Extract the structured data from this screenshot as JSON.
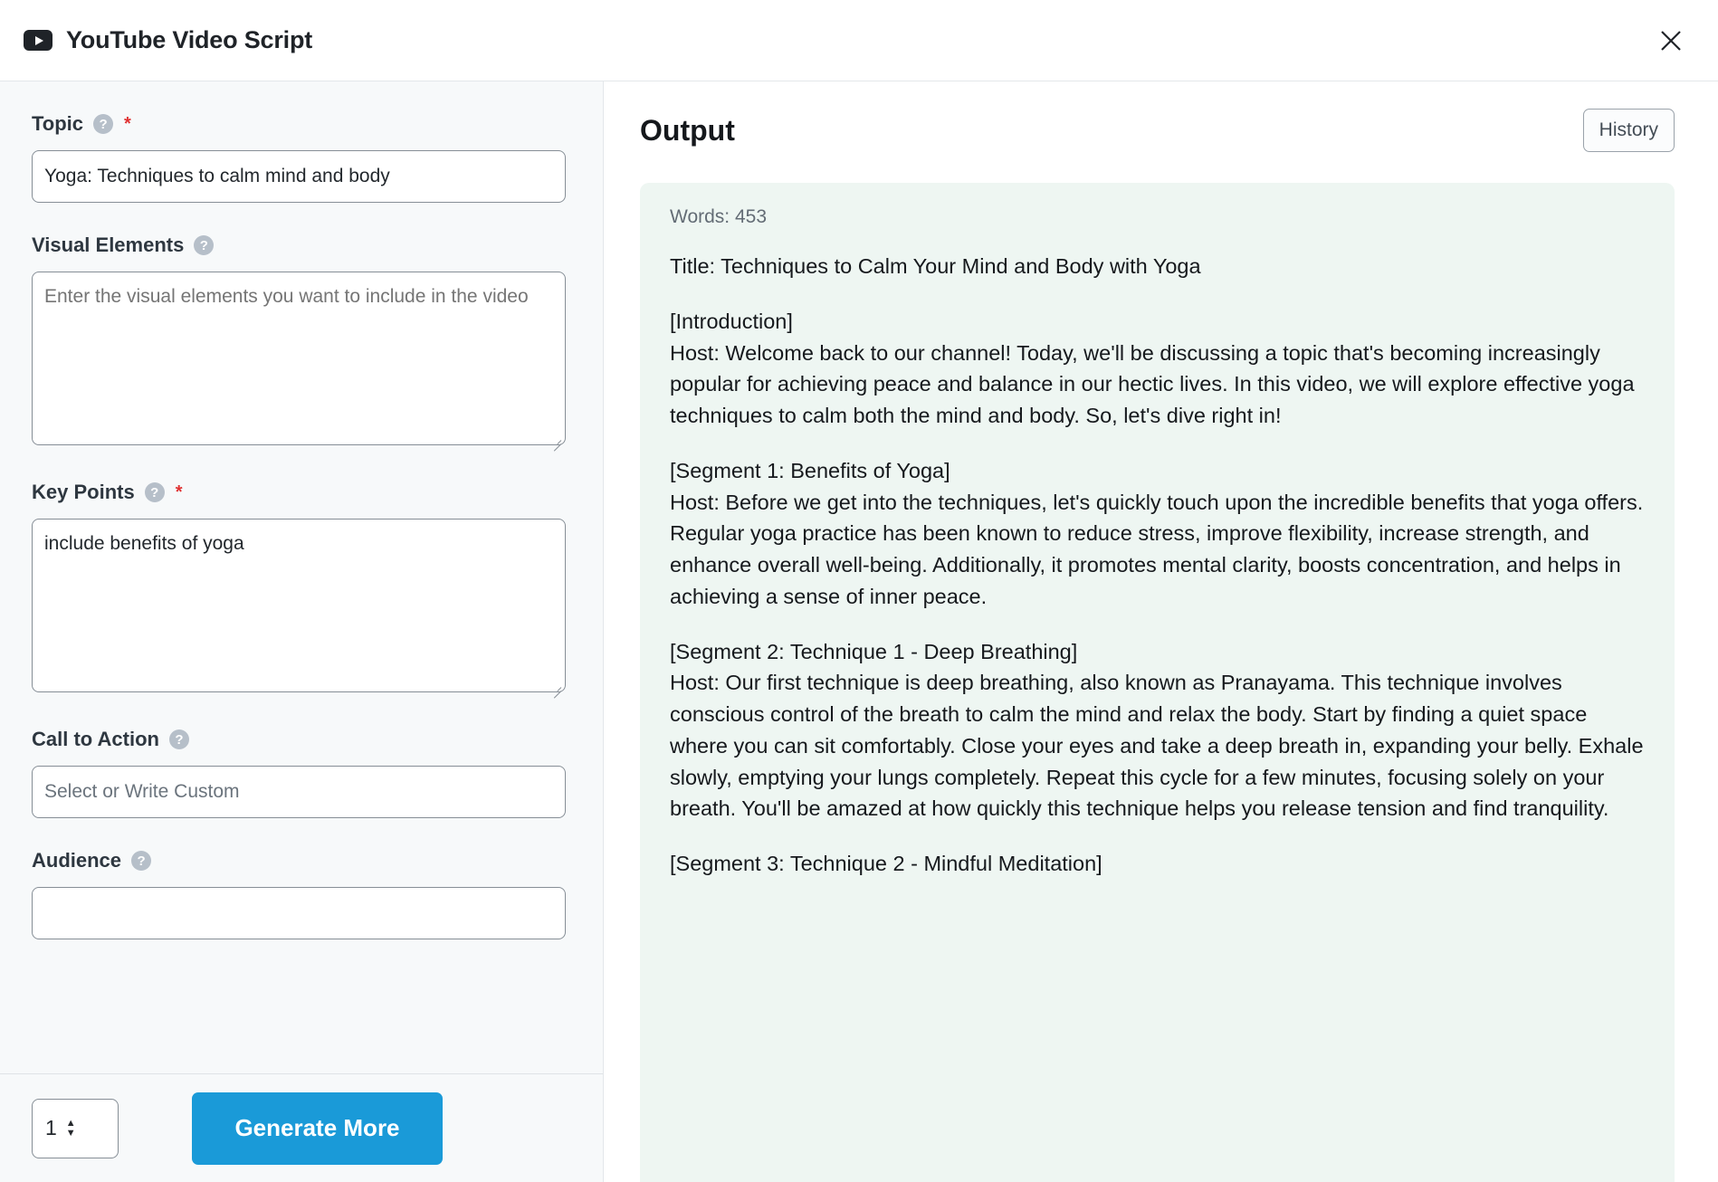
{
  "header": {
    "title": "YouTube Video Script",
    "logo_icon": "youtube-play-icon",
    "close_icon": "close-icon"
  },
  "form": {
    "fields": [
      {
        "label": "Topic",
        "help_icon": "help-circle-icon",
        "required_marker": "*",
        "type": "text",
        "value": "Yoga: Techniques to calm mind and body",
        "placeholder": ""
      },
      {
        "label": "Visual Elements",
        "help_icon": "help-circle-icon",
        "required_marker": "",
        "type": "textarea",
        "value": "",
        "placeholder": "Enter the visual elements you want to include in the video"
      },
      {
        "label": "Key Points",
        "help_icon": "help-circle-icon",
        "required_marker": "*",
        "type": "textarea",
        "value": "include benefits of yoga",
        "placeholder": ""
      },
      {
        "label": "Call to Action",
        "help_icon": "help-circle-icon",
        "required_marker": "",
        "type": "text",
        "value": "",
        "placeholder": "Select or Write Custom"
      },
      {
        "label": "Audience",
        "help_icon": "help-circle-icon",
        "required_marker": "",
        "type": "text",
        "value": "",
        "placeholder": ""
      }
    ]
  },
  "footer": {
    "count_value": "1",
    "stepper_up_icon": "chevron-up-icon",
    "stepper_down_icon": "chevron-down-icon",
    "generate_label": "Generate More"
  },
  "output": {
    "title": "Output",
    "history_label": "History",
    "words_label": "Words: 453",
    "paragraphs": [
      "Title: Techniques to Calm Your Mind and Body with Yoga",
      "[Introduction]\nHost: Welcome back to our channel! Today, we'll be discussing a topic that's becoming increasingly popular for achieving peace and balance in our hectic lives. In this video, we will explore effective yoga techniques to calm both the mind and body. So, let's dive right in!",
      "[Segment 1: Benefits of Yoga]\nHost: Before we get into the techniques, let's quickly touch upon the incredible benefits that yoga offers. Regular yoga practice has been known to reduce stress, improve flexibility, increase strength, and enhance overall well-being. Additionally, it promotes mental clarity, boosts concentration, and helps in achieving a sense of inner peace.",
      "[Segment 2: Technique 1 - Deep Breathing]\nHost: Our first technique is deep breathing, also known as Pranayama. This technique involves conscious control of the breath to calm the mind and relax the body. Start by finding a quiet space where you can sit comfortably. Close your eyes and take a deep breath in, expanding your belly. Exhale slowly, emptying your lungs completely. Repeat this cycle for a few minutes, focusing solely on your breath. You'll be amazed at how quickly this technique helps you release tension and find tranquility.",
      "[Segment 3: Technique 2 - Mindful Meditation]"
    ]
  },
  "colors": {
    "accent_blue": "#1a9ad8",
    "required_red": "#e03131",
    "output_card_bg": "#eef6f2",
    "panel_bg": "#f7f9fa"
  }
}
